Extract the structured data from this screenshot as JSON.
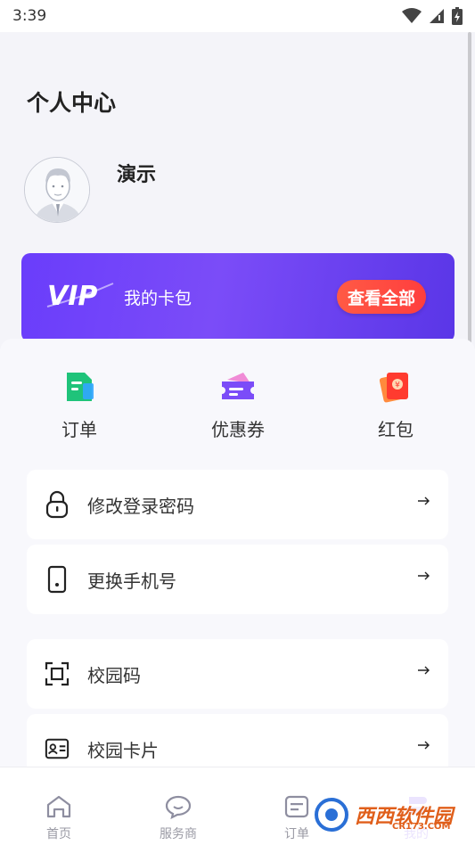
{
  "status_bar": {
    "time": "3:39"
  },
  "page": {
    "title": "个人中心"
  },
  "profile": {
    "name": "演示"
  },
  "vip": {
    "logo_text": "VIP",
    "title": "我的卡包",
    "button": "查看全部"
  },
  "quick_actions": [
    {
      "label": "订单",
      "icon": "order-doc-icon",
      "color": "#1fc37a"
    },
    {
      "label": "优惠券",
      "icon": "coupon-icon",
      "color": "#7b4cf8"
    },
    {
      "label": "红包",
      "icon": "red-packet-icon",
      "color": "#ff4b2b"
    }
  ],
  "menu": [
    {
      "label": "修改登录密码",
      "icon": "lock-icon"
    },
    {
      "label": "更换手机号",
      "icon": "phone-icon"
    },
    {
      "label": "校园码",
      "icon": "scan-code-icon"
    },
    {
      "label": "校园卡片",
      "icon": "id-card-icon"
    }
  ],
  "tabs": [
    {
      "label": "首页",
      "icon": "home-icon"
    },
    {
      "label": "服务商",
      "icon": "chat-bubble-icon"
    },
    {
      "label": "订单",
      "icon": "order-list-icon"
    },
    {
      "label": "我的",
      "icon": "profile-icon"
    }
  ],
  "watermark": {
    "text": "西西软件园",
    "sub": "CR173.COM"
  },
  "colors": {
    "accent": "#6a3dfb",
    "vip_button": "#ff3e3e",
    "background": "#f4f4f9"
  }
}
